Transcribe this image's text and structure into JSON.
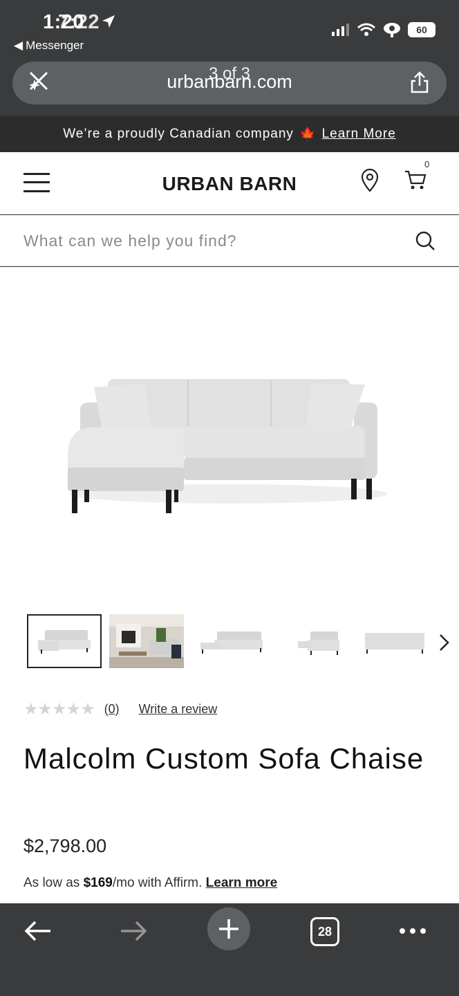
{
  "status_bar": {
    "time": "1:20",
    "time_overlay": "7:22",
    "back_app": "Messenger",
    "battery": "60"
  },
  "browser": {
    "url": "urbanbarn.com",
    "find_overlay": "3 of 3",
    "tab_count": "28"
  },
  "banner": {
    "text": "We’re a proudly Canadian company",
    "emoji": "🍁",
    "link": "Learn More"
  },
  "header": {
    "logo": "URBAN BARN",
    "cart_count": "0"
  },
  "search": {
    "placeholder": "What can we help you find?"
  },
  "product": {
    "stars": "★★★★★",
    "review_count": "(0)",
    "write_review": "Write a review",
    "title": "Malcolm Custom Sofa Chaise",
    "price": "$2,798.00",
    "affirm_prefix": "As low as ",
    "affirm_amount": "$169",
    "affirm_suffix": "/mo with Affirm. ",
    "affirm_link": "Learn more",
    "rating_value": 0,
    "thumbnails": [
      "front-view",
      "room-scene",
      "angle-view",
      "side-view",
      "back-view"
    ]
  },
  "colors": {
    "chrome": "#3a3b3c",
    "banner": "#2c2c2d",
    "sofa": "#dedede"
  }
}
